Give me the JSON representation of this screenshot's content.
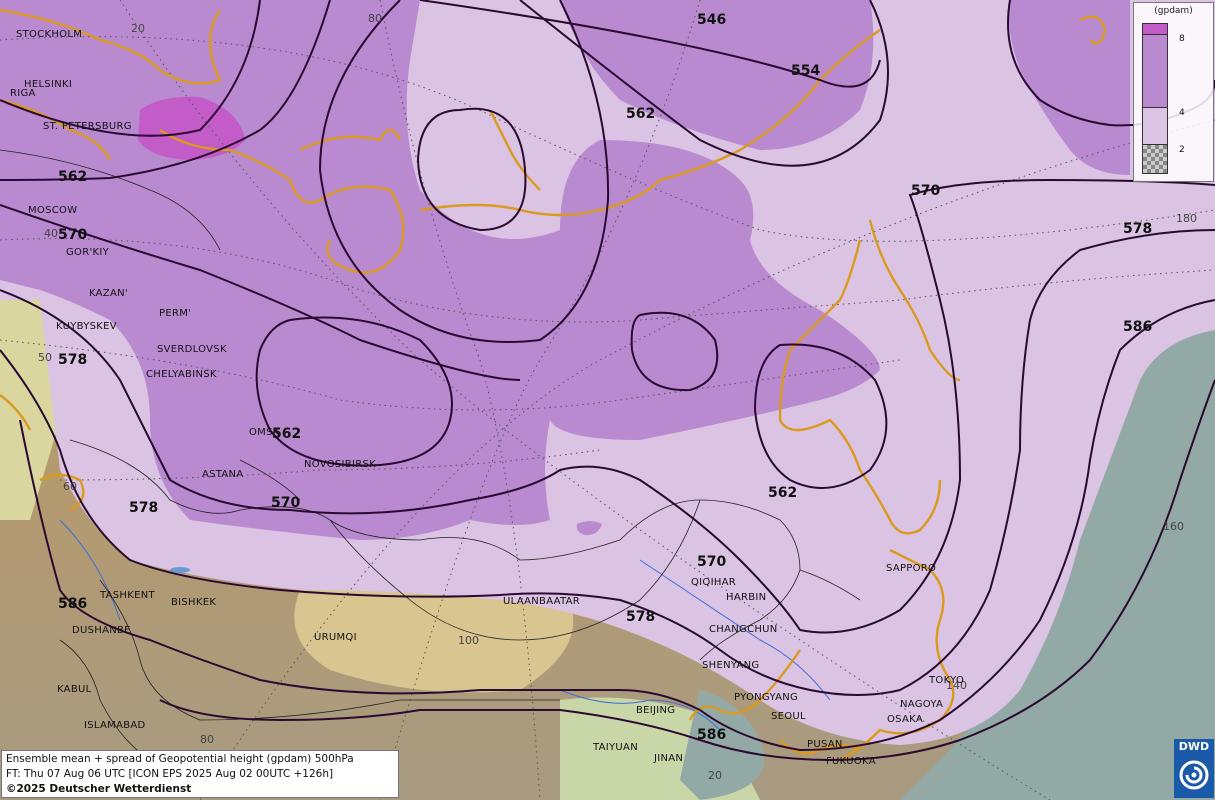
{
  "legend": {
    "unit": "(gpdam)",
    "ticks": [
      "8",
      "4",
      "2"
    ],
    "colors": {
      "high": "#c35bc8",
      "mid": "#b98ad0",
      "low": "#d9c2e2",
      "none": "checker"
    }
  },
  "info": {
    "line1": "Ensemble mean + spread of Geopotential height (gpdam) 500hPa",
    "line2": "FT: Thu 07 Aug 06 UTC [ICON EPS 2025 Aug 02 00UTC +126h]",
    "copyright": "©2025 Deutscher Wetterdienst"
  },
  "logo": {
    "text": "DWD"
  },
  "cities": {
    "stockholm": "STOCKHOLM",
    "helsinki": "HELSINKI",
    "riga": "RIGA",
    "st_petersburg": "ST. PETERSBURG",
    "moscow": "MOSCOW",
    "gorkiy": "GOR'KIY",
    "kazan": "KAZAN'",
    "perm": "PERM'",
    "kuybyshev": "KUYBYSKEV",
    "sverdlovsk": "SVERDLOVSK",
    "chelyabinsk": "CHELYABINSK",
    "omsk": "OMSK",
    "novosibirsk": "NOVOSIBIRSK",
    "astana": "ASTANA",
    "tashkent": "TASHKENT",
    "bishkek": "BISHKEK",
    "dushanbe": "DUSHANBE",
    "urumqi": "URUMQI",
    "kabul": "KABUL",
    "islamabad": "ISLAMABAD",
    "ulaanbaatar": "ULAANBAATAR",
    "qiqihar": "QIQIHAR",
    "harbin": "HARBIN",
    "changchun": "CHANGCHUN",
    "shenyang": "SHENYANG",
    "pyongyang": "PYONGYANG",
    "seoul": "SEOUL",
    "beijing": "BEIJING",
    "taiyuan": "TAIYUAN",
    "jinan": "JINAN",
    "pusan": "PUSAN",
    "fukuoka": "FUKUOKA",
    "osaka": "OSAKA",
    "nagoya": "NAGOYA",
    "tokyo": "TOKYO",
    "sapporo": "SAPPORO"
  },
  "contours": {
    "c546": "546",
    "c554": "554",
    "c562a": "562",
    "c562b": "562",
    "c562c": "562",
    "c562d": "562",
    "c570a": "570",
    "c570b": "570",
    "c570c": "570",
    "c570d": "570",
    "c578a": "578",
    "c578b": "578",
    "c578c": "578",
    "c578d": "578",
    "c586a": "586",
    "c586b": "586",
    "c586c": "586"
  },
  "graticule": {
    "g20a": "20",
    "g80a": "80",
    "g40": "40",
    "g50": "50",
    "g60": "60",
    "g100": "100",
    "g80b": "80",
    "g20b": "20",
    "g140": "140",
    "g160": "160",
    "g180": "180"
  }
}
